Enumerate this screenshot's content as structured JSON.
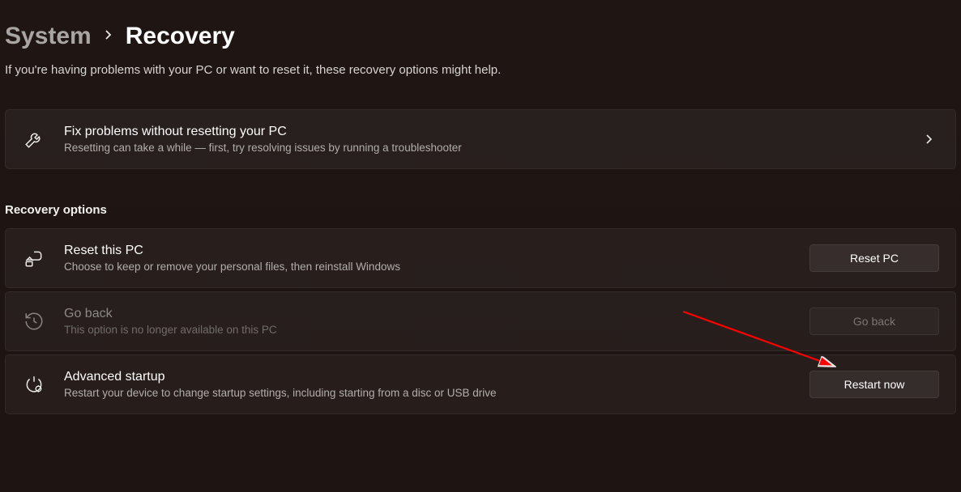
{
  "breadcrumb": {
    "parent": "System",
    "current": "Recovery"
  },
  "subtitle": "If you're having problems with your PC or want to reset it, these recovery options might help.",
  "fixCard": {
    "title": "Fix problems without resetting your PC",
    "desc": "Resetting can take a while — first, try resolving issues by running a troubleshooter"
  },
  "sectionHeader": "Recovery options",
  "options": {
    "reset": {
      "title": "Reset this PC",
      "desc": "Choose to keep or remove your personal files, then reinstall Windows",
      "button": "Reset PC"
    },
    "goback": {
      "title": "Go back",
      "desc": "This option is no longer available on this PC",
      "button": "Go back"
    },
    "advanced": {
      "title": "Advanced startup",
      "desc": "Restart your device to change startup settings, including starting from a disc or USB drive",
      "button": "Restart now"
    }
  }
}
